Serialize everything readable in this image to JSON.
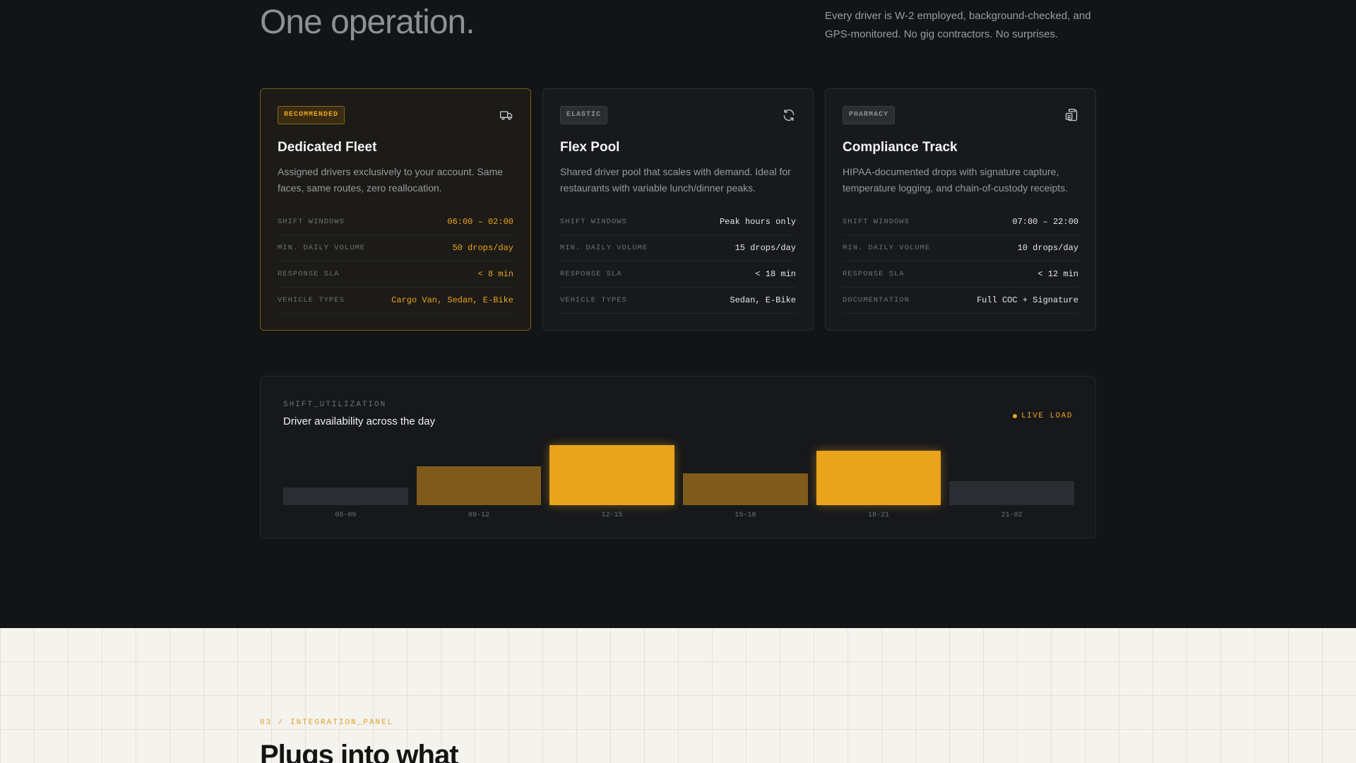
{
  "hero": {
    "headline": "One operation.",
    "intro": "Every driver is W-2 employed, background-checked, and GPS-monitored. No gig contractors. No surprises."
  },
  "cards": [
    {
      "badge": "RECOMMENDED",
      "icon": "truck-icon",
      "title": "Dedicated Fleet",
      "description": "Assigned drivers exclusively to your account. Same faces, same routes, zero reallocation.",
      "specs": [
        {
          "key": "SHIFT WINDOWS",
          "value": "06:00 – 02:00"
        },
        {
          "key": "MIN. DAILY VOLUME",
          "value": "50 drops/day"
        },
        {
          "key": "RESPONSE SLA",
          "value": "< 8 min"
        },
        {
          "key": "VEHICLE TYPES",
          "value": "Cargo Van, Sedan, E-Bike"
        }
      ]
    },
    {
      "badge": "ELASTIC",
      "icon": "refresh-icon",
      "title": "Flex Pool",
      "description": "Shared driver pool that scales with demand. Ideal for restaurants with variable lunch/dinner peaks.",
      "specs": [
        {
          "key": "SHIFT WINDOWS",
          "value": "Peak hours only"
        },
        {
          "key": "MIN. DAILY VOLUME",
          "value": "15 drops/day"
        },
        {
          "key": "RESPONSE SLA",
          "value": "< 18 min"
        },
        {
          "key": "VEHICLE TYPES",
          "value": "Sedan, E-Bike"
        }
      ]
    },
    {
      "badge": "PHARMACY",
      "icon": "clipboard-icon",
      "title": "Compliance Track",
      "description": "HIPAA-documented drops with signature capture, temperature logging, and chain-of-custody receipts.",
      "specs": [
        {
          "key": "SHIFT WINDOWS",
          "value": "07:00 – 22:00"
        },
        {
          "key": "MIN. DAILY VOLUME",
          "value": "10 drops/day"
        },
        {
          "key": "RESPONSE SLA",
          "value": "< 12 min"
        },
        {
          "key": "DOCUMENTATION",
          "value": "Full COC + Signature"
        }
      ]
    }
  ],
  "utilization": {
    "kicker": "SHIFT_UTILIZATION",
    "title": "Driver availability across the day",
    "live_label": "LIVE LOAD"
  },
  "chart_data": {
    "type": "bar",
    "title": "Driver availability across the day",
    "categories": [
      "06-09",
      "09-12",
      "12-15",
      "15-18",
      "18-21",
      "21-02"
    ],
    "values": [
      25,
      55,
      85,
      45,
      77,
      34
    ],
    "levels": [
      "low",
      "mid",
      "high",
      "mid",
      "high",
      "low"
    ],
    "ylim": [
      0,
      100
    ],
    "colors": {
      "low": "#2A2D31",
      "mid": "#7F5B1B",
      "high": "#E9A41C"
    }
  },
  "integration": {
    "kicker": "03 / INTEGRATION_PANEL",
    "title": "Plugs into what"
  }
}
